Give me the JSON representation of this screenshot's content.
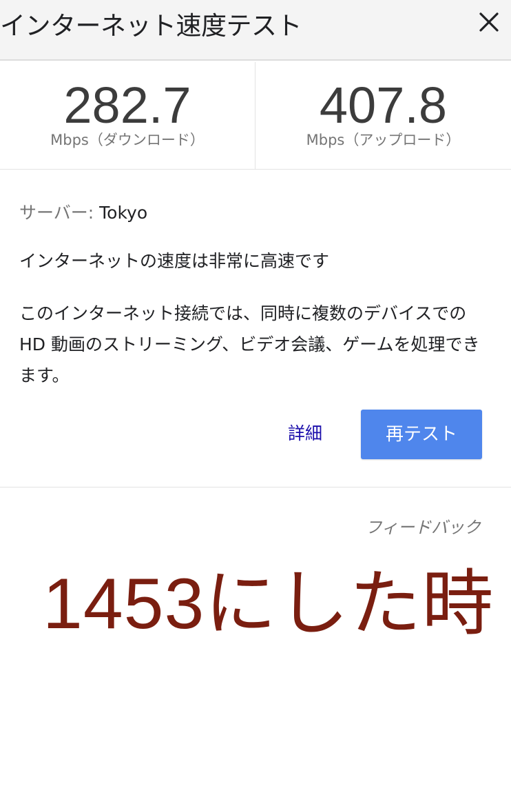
{
  "header": {
    "title": "インターネット速度テスト",
    "close_icon": "close-icon"
  },
  "results": {
    "download": {
      "value": "282.7",
      "unit": "Mbps（ダウンロード）"
    },
    "upload": {
      "value": "407.8",
      "unit": "Mbps（アップロード）"
    }
  },
  "info": {
    "server_label": "サーバー: ",
    "server_value": "Tokyo",
    "verdict": "インターネットの速度は非常に高速です",
    "description": "このインターネット接続では、同時に複数のデバイスでの HD 動画のストリーミング、ビデオ会議、ゲームを処理できます。"
  },
  "actions": {
    "details_label": "詳細",
    "retest_label": "再テスト"
  },
  "feedback_label": "フィードバック",
  "annotation": "1453にした時",
  "colors": {
    "accent_button": "#4f86ec",
    "link": "#1a0dab",
    "annotation": "#7a1e10",
    "header_bg": "#f4f4f4"
  }
}
